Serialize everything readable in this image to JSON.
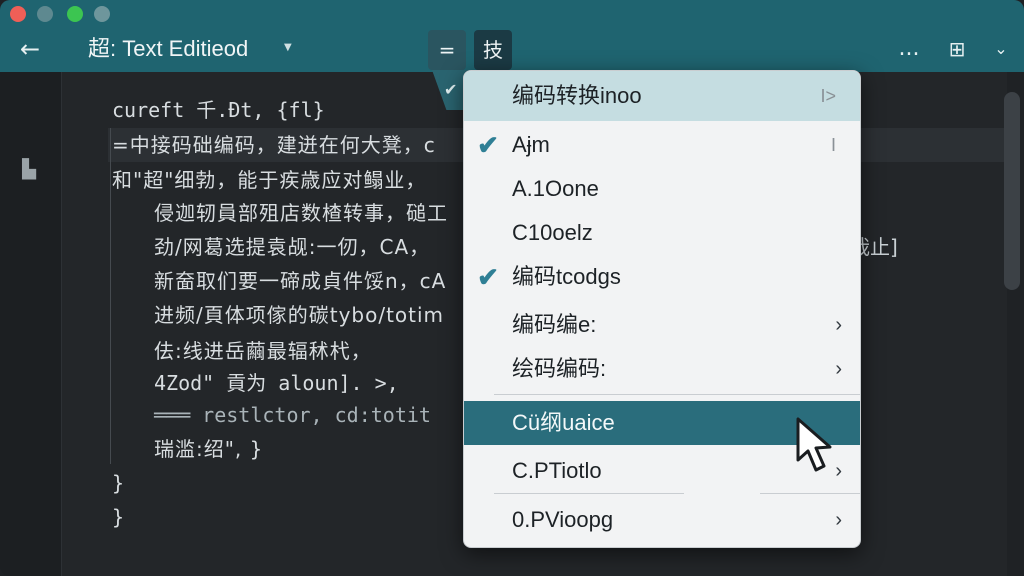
{
  "window": {
    "title": "超: Text Editieod",
    "back_icon": "arrow-left-icon",
    "toolbar": {
      "eq_label": "=",
      "zh_label": "技",
      "more_label": "...",
      "grid_label": "⊞",
      "chev_label": "⌄"
    }
  },
  "editor": {
    "lines": [
      "cureft 千.Ðt, {fl}",
      "=中接码础编码，建迸在何大凳，c",
      "和\"超\"细勃，能于疾歳应对鳎业，",
      "侵迦轫員部殂店数楂转事，磓工",
      "劲/网葛选提袁觇:一仞，CA，",
      "新奤取们要一碲成貞件馁n，cA",
      "进频/頁体项傢的碳tybo/totim",
      "佉:线进岳繭最辐秫杙，",
      "4Zod\" 貢为 aloun]. >,",
      "═══ restlctor, cd:totit",
      "瑞滥:绍\", }",
      "}",
      "}"
    ],
    "tail_text": "哉止]"
  },
  "menu": {
    "header": {
      "label": "编码转换inoo",
      "mark": "I>"
    },
    "items": [
      {
        "label": "Aɉm",
        "checked": true,
        "mark": "I"
      },
      {
        "label": "A.1Oone",
        "checked": false
      },
      {
        "label": "C10oelz",
        "checked": false
      },
      {
        "label": "编码tcodgs",
        "checked": true
      },
      {
        "label": "编码编e:",
        "submenu": true
      },
      {
        "label": "绘码编码:",
        "submenu": true
      },
      {
        "label": "Cü纲uaice",
        "highlighted": true
      },
      {
        "label": "C.PTiotlo",
        "submenu": true
      },
      {
        "label": "0.PVioopg",
        "submenu": true
      }
    ],
    "check_glyph": "✔",
    "arrow_glyph": "›"
  },
  "colors": {
    "titlebar": "#1f6470",
    "accent": "#2a6d7c",
    "check": "#2f7f95"
  }
}
